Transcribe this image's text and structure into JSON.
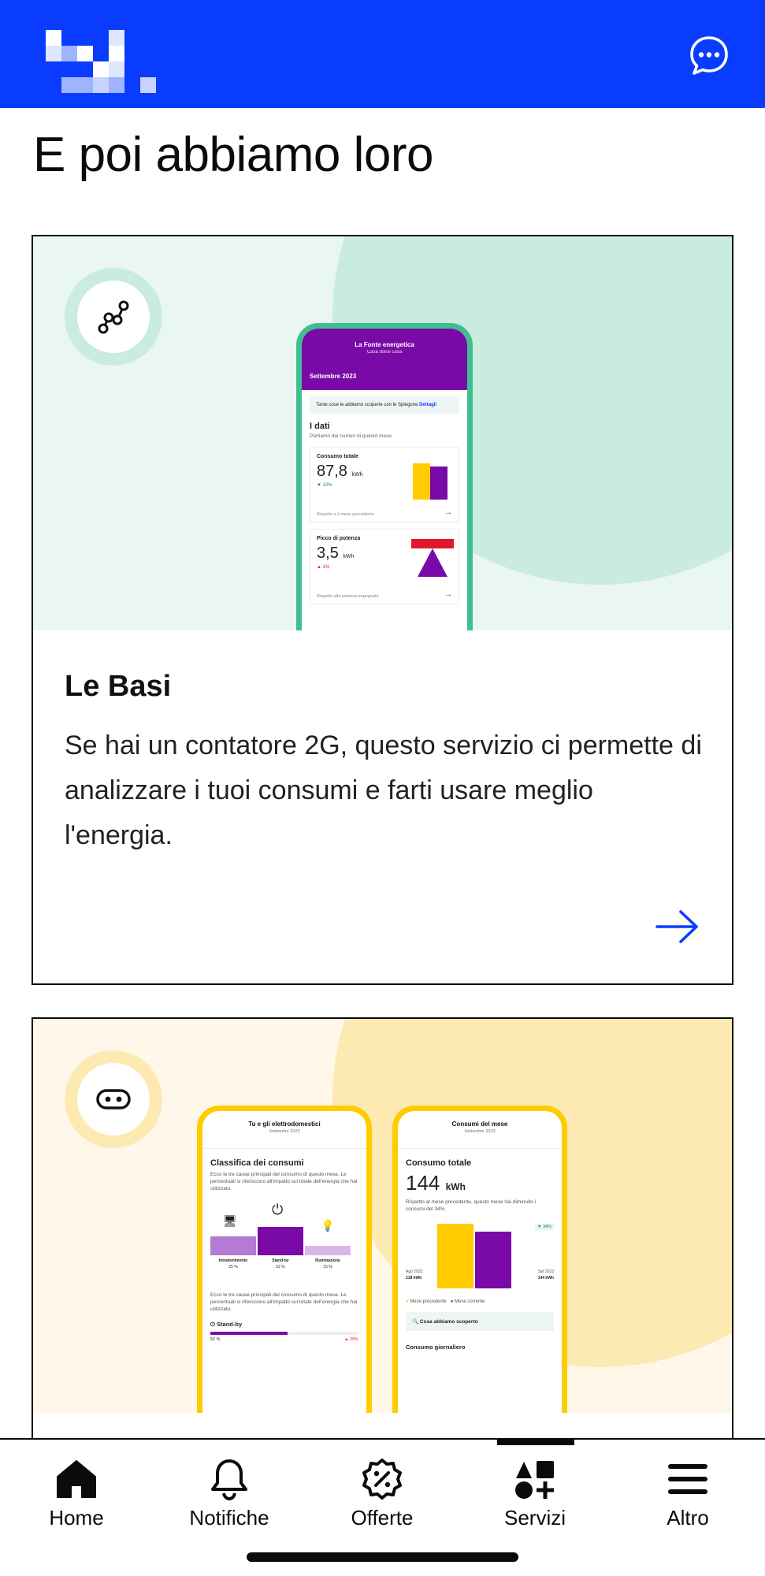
{
  "header": {
    "brand_color": "#0a3cff",
    "logo": "pixel-logo",
    "chat_icon": "chat-bubble-icon"
  },
  "section": {
    "title": "E poi abbiamo loro"
  },
  "cards": [
    {
      "icon": "graph-nodes-icon",
      "title": "Le Basi",
      "description": "Se hai un contatore 2G, questo servizio ci permette di analizzare i tuoi consumi e farti usare meglio l'energia.",
      "arrow_icon": "arrow-right-icon",
      "accent_color": "#c9ecdf",
      "phone": {
        "header_title": "La Fonte energetica",
        "header_subtitle": "Casa dolce casa",
        "month": "Settembre 2023",
        "tip": "Tante cose le abbiamo scoperte con le Spiegone",
        "tip_link": "Dettagli",
        "data_title": "I dati",
        "data_subtitle": "Partiamo dai numeri di questo mese.",
        "metric1_label": "Consumo totale",
        "metric1_value": "87,8",
        "metric1_unit": "kWh",
        "metric1_delta": "▼ 10%",
        "metric1_foot": "Rispetto a il mese precedente",
        "metric2_label": "Picco di potenza",
        "metric2_value": "3,5",
        "metric2_unit": "kWh",
        "metric2_delta": "▲ 1%",
        "metric2_foot": "Rispetto alla potenza impegnata"
      }
    },
    {
      "icon": "robot-face-icon",
      "accent_color": "#fde9b2",
      "phone_a": {
        "title": "Tu e gli elettrodomestici",
        "subtitle": "Settembre 2023",
        "heading": "Classifica dei consumi",
        "body": "Ecco le tre cause principali del consumo di questo mese. Le percentuali si riferiscono all'impatto sul totale dell'energia che hai utilizzato.",
        "bars": [
          {
            "label": "Intrattenimento",
            "pct": "25 %"
          },
          {
            "label": "Stand-by",
            "pct": "52 %"
          },
          {
            "label": "Illuminazione",
            "pct": "15 %"
          }
        ],
        "standby_label": "Stand-by",
        "standby_pct": "52 %",
        "standby_delta": "▲ 20%"
      },
      "phone_b": {
        "title": "Consumi del mese",
        "subtitle": "Settembre 2023",
        "heading": "Consumo totale",
        "value": "144",
        "unit": "kWh",
        "body": "Rispetto al mese precedente, questo mese hai diminuito i consumi del 34%.",
        "delta": "▼ 34%",
        "left_label": "Ago 2023",
        "left_value": "218 kWh",
        "right_label": "Set 2023",
        "right_value": "144 kWh",
        "legend_prev": "Mese precedente",
        "legend_curr": "Mese corrente",
        "discover": "Cosa abbiamo scoperto",
        "footer": "Consumo giornaliero"
      }
    }
  ],
  "tabbar": {
    "active": "Servizi",
    "items": [
      {
        "label": "Home",
        "icon": "home-icon"
      },
      {
        "label": "Notifiche",
        "icon": "bell-icon"
      },
      {
        "label": "Offerte",
        "icon": "percent-badge-icon"
      },
      {
        "label": "Servizi",
        "icon": "shapes-icon"
      },
      {
        "label": "Altro",
        "icon": "menu-icon"
      }
    ]
  }
}
